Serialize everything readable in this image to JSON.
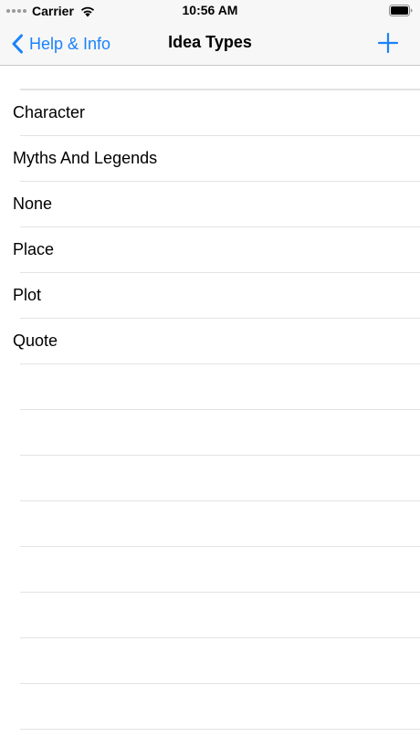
{
  "status_bar": {
    "carrier": "Carrier",
    "time": "10:56 AM"
  },
  "nav": {
    "back_label": "Help & Info",
    "title": "Idea Types",
    "accent_color": "#1a82fb"
  },
  "idea_types": {
    "items": [
      {
        "label": "Character"
      },
      {
        "label": "Myths And Legends"
      },
      {
        "label": "None"
      },
      {
        "label": "Place"
      },
      {
        "label": "Plot"
      },
      {
        "label": "Quote"
      }
    ]
  },
  "icons": [
    "signal-dots-icon",
    "wifi-icon",
    "battery-icon",
    "chevron-left-icon",
    "plus-icon"
  ]
}
